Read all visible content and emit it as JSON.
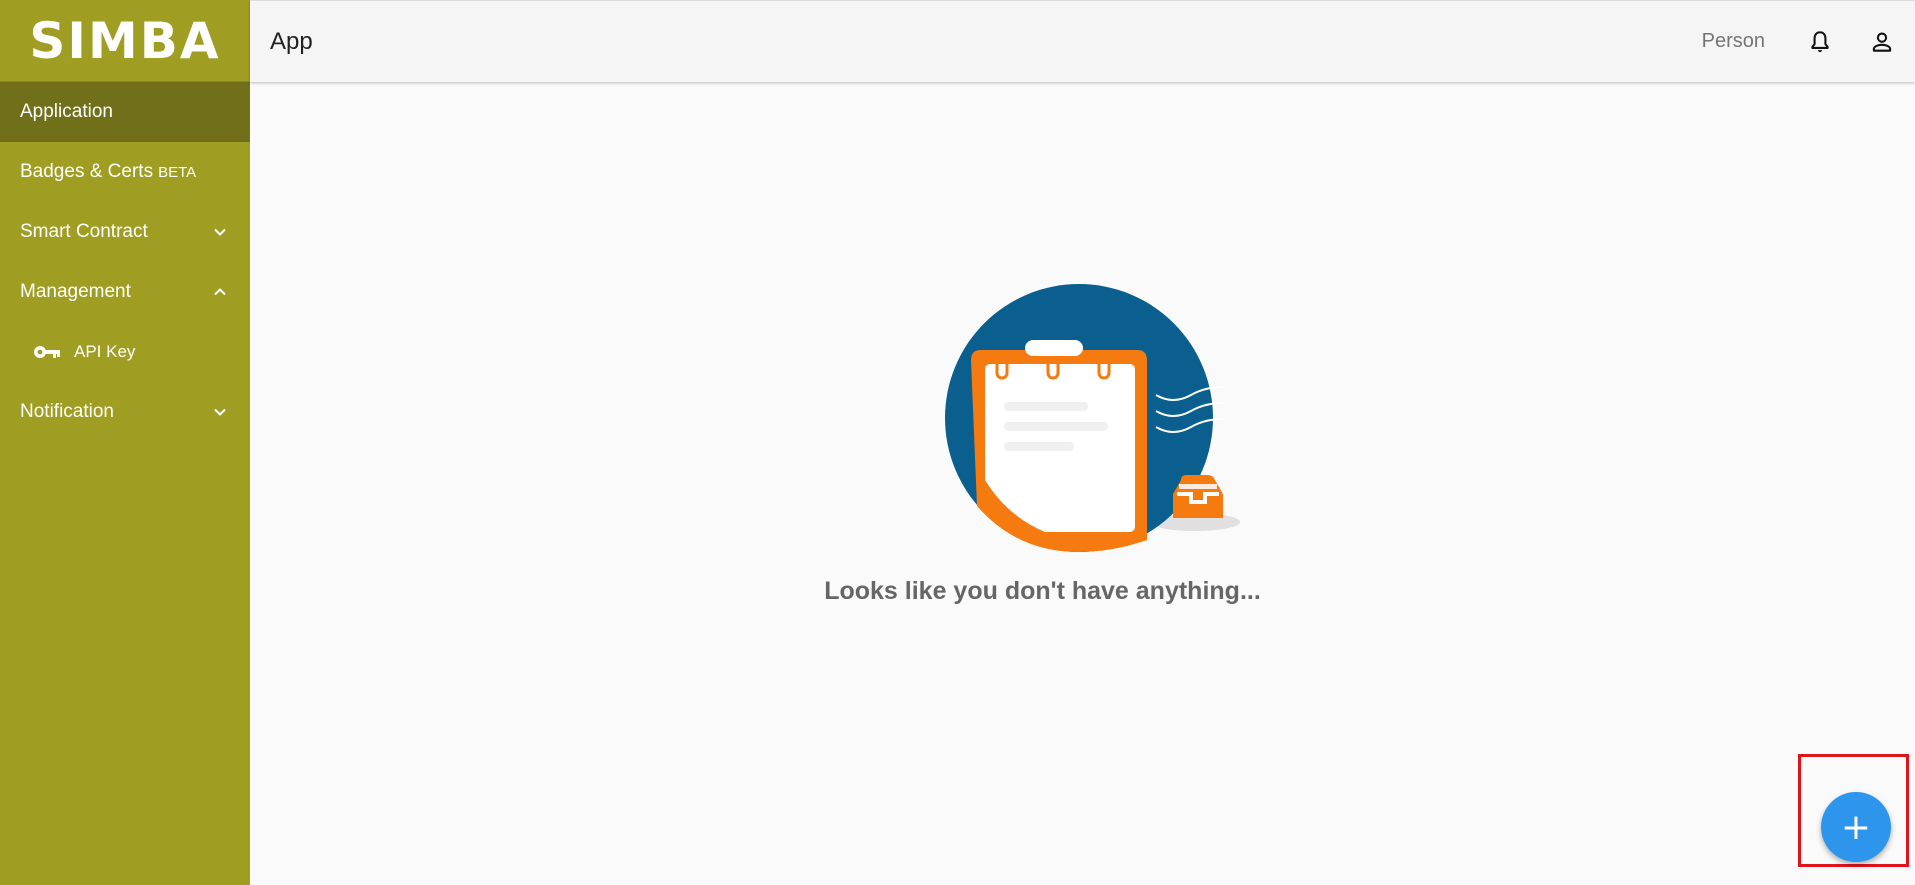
{
  "brand": {
    "logo_text": "SIMBA",
    "sidebar_color": "#a09e22",
    "active_color": "#716f19"
  },
  "sidebar": {
    "items": [
      {
        "label": "Application",
        "active": true
      },
      {
        "label": "Badges & Certs",
        "badge": "BETA"
      },
      {
        "label": "Smart Contract",
        "chevron": "chevron-down-icon"
      },
      {
        "label": "Management",
        "chevron": "chevron-up-icon"
      },
      {
        "label": "API Key",
        "icon": "key-icon",
        "sub": true
      },
      {
        "label": "Notification",
        "chevron": "chevron-down-icon"
      }
    ]
  },
  "header": {
    "title": "App",
    "user_label": "Person",
    "icons": [
      "bell-icon",
      "account-icon"
    ]
  },
  "main": {
    "empty_message": "Looks like you don't have anything...",
    "illustration": "empty-clipboard-illustration"
  },
  "fab": {
    "label": "+",
    "icon": "plus-icon",
    "color": "#2e95ec",
    "highlight_color": "#e0141c"
  }
}
